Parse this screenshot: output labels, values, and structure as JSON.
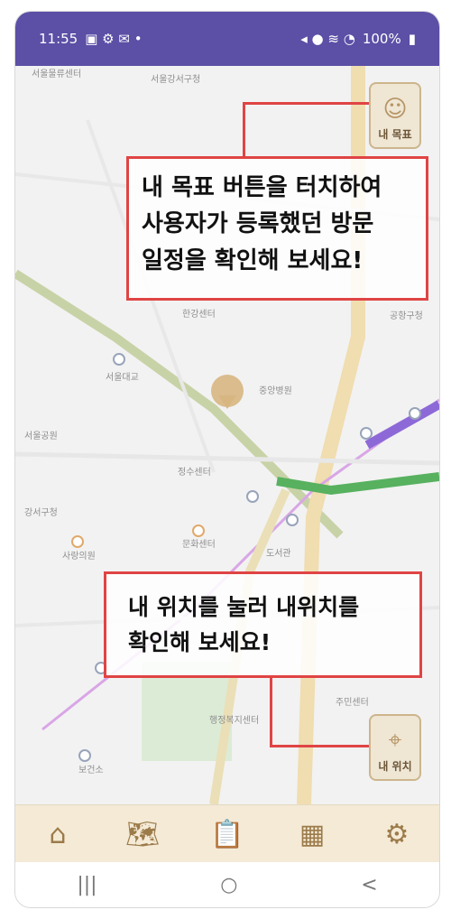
{
  "status": {
    "time": "11:55",
    "battery": "100%"
  },
  "map": {
    "labels": [
      "서울물류센터",
      "서울강서구청",
      "공항구청",
      "서울대교",
      "한강센터",
      "서울공원",
      "정수센터",
      "중앙병원",
      "강서구청",
      "사랑의원",
      "문화센터",
      "도서관",
      "보건소",
      "행정복지센터",
      "주민센터"
    ]
  },
  "fab": {
    "goal_label": "내 목표",
    "location_label": "내 위치"
  },
  "callouts": {
    "goal_line1": "내 목표 버튼을 터치하여",
    "goal_line2": "사용자가 등록했던 방문",
    "goal_line3": "일정을 확인해 보세요!",
    "location_line1": "내 위치를 눌러 내위치를",
    "location_line2": "확인해 보세요!"
  },
  "bottomnav": [
    "home-icon",
    "map-icon",
    "clipboard-icon",
    "calculator-icon",
    "gear-icon"
  ],
  "sysnav": {
    "recent": "|||",
    "home": "○",
    "back": "<"
  }
}
